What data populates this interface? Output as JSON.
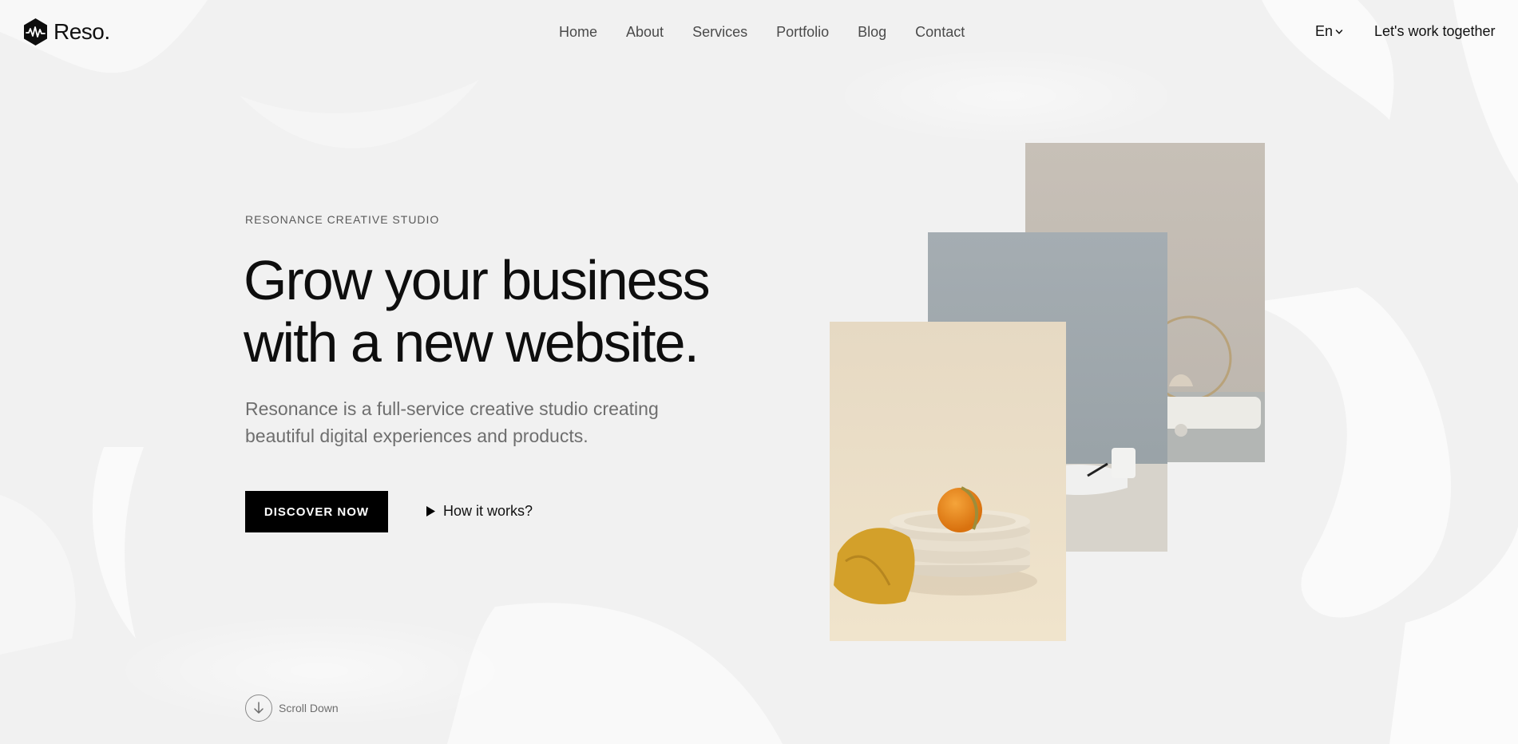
{
  "brand": {
    "name": "Reso."
  },
  "nav": {
    "items": [
      {
        "label": "Home"
      },
      {
        "label": "About"
      },
      {
        "label": "Services"
      },
      {
        "label": "Portfolio"
      },
      {
        "label": "Blog"
      },
      {
        "label": "Contact"
      }
    ]
  },
  "header": {
    "language": "En",
    "cta_label": "Let's work together"
  },
  "hero": {
    "eyebrow": "RESONANCE CREATIVE STUDIO",
    "headline_line1": "Grow your business",
    "headline_line2": "with a new website.",
    "subtitle": "Resonance is a full-service creative studio creating beautiful digital experiences and products.",
    "primary_button": "DISCOVER NOW",
    "secondary_link": "How it works?",
    "scroll_label": "Scroll Down"
  },
  "icons": {
    "logo": "wave-hexagon-icon",
    "language_toggle": "chevron-down-icon",
    "play": "play-icon",
    "scroll": "arrow-down-icon"
  },
  "colors": {
    "background": "#f1f1f1",
    "text_primary": "#0e0e0e",
    "text_muted": "#6e6e6e",
    "button_bg": "#000000",
    "button_text": "#ffffff"
  }
}
